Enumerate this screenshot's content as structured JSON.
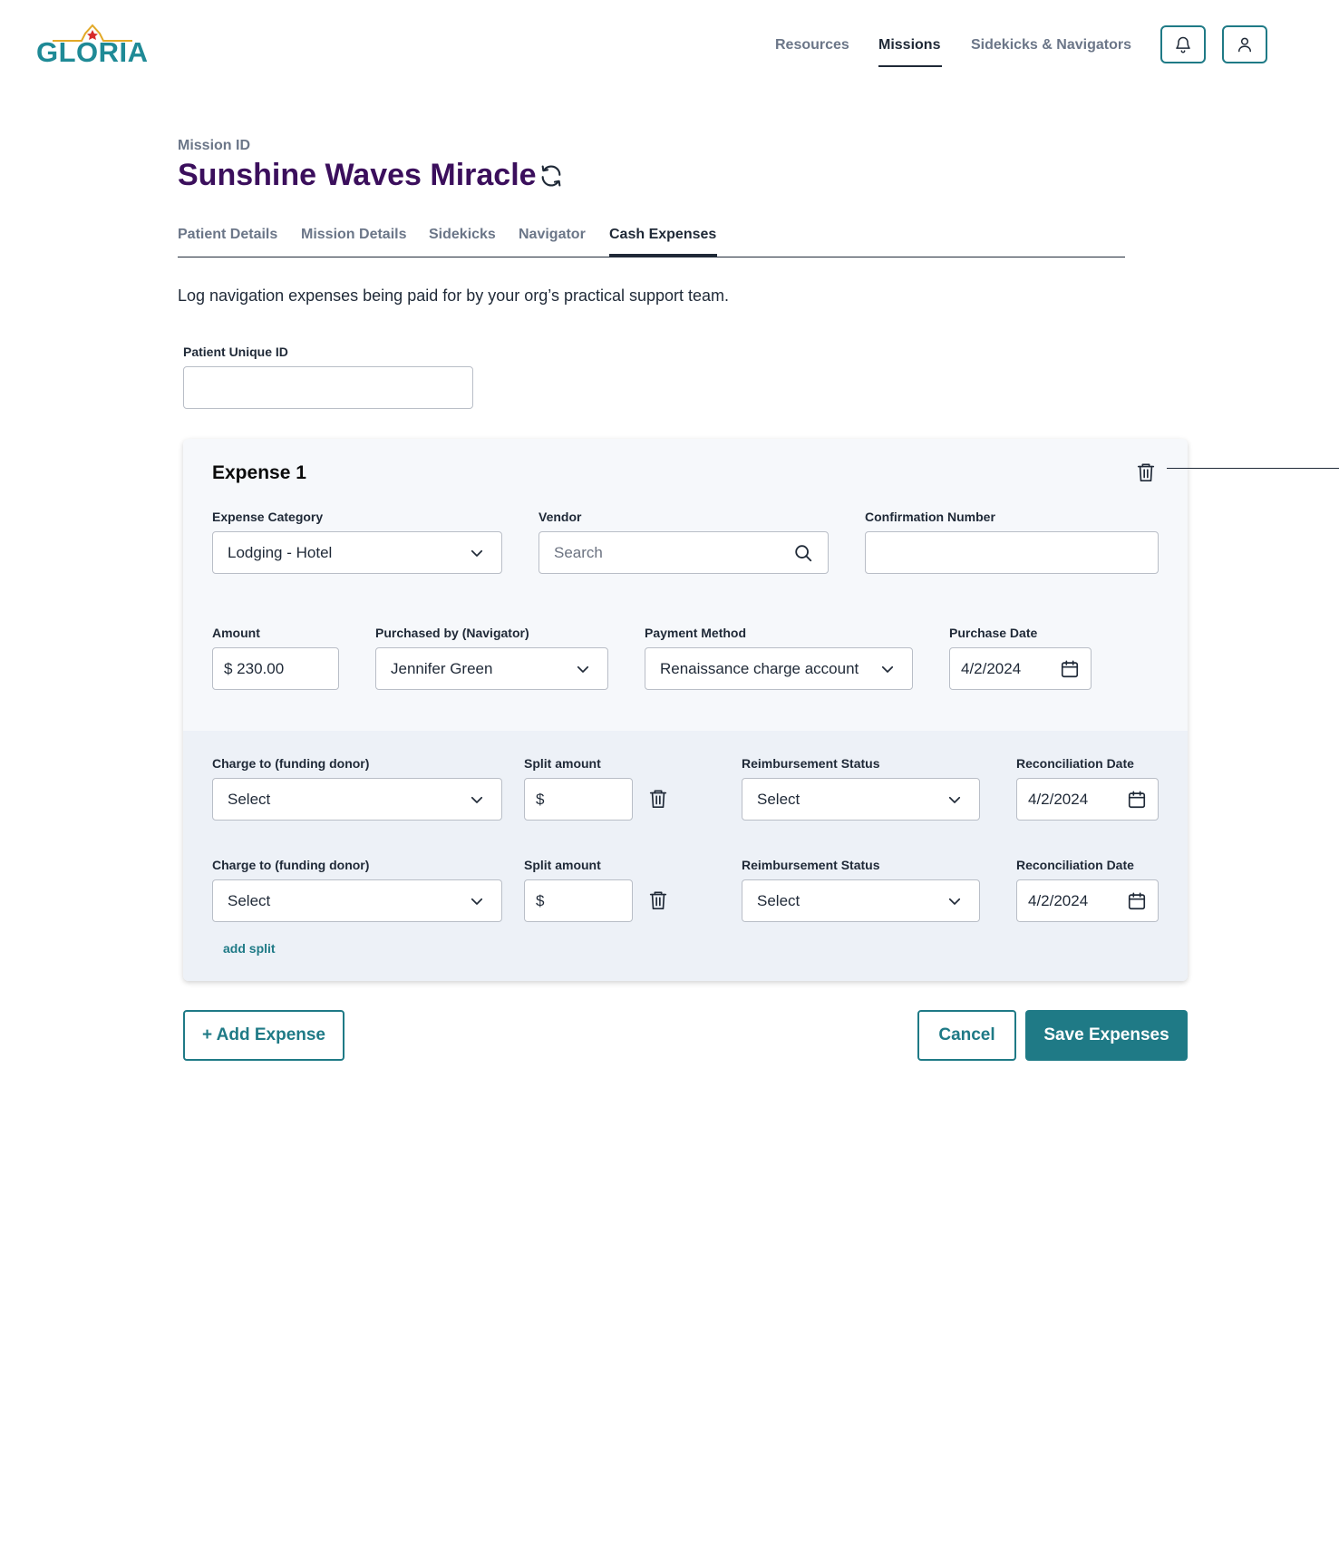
{
  "header": {
    "logo_text": "GLORIA",
    "nav": [
      {
        "label": "Resources"
      },
      {
        "label": "Missions"
      },
      {
        "label": "Sidekicks & Navigators"
      }
    ],
    "active_nav": "Missions"
  },
  "mission": {
    "id_label": "Mission ID",
    "title": "Sunshine Waves Miracle"
  },
  "tabs": [
    {
      "label": "Patient Details"
    },
    {
      "label": "Mission Details"
    },
    {
      "label": "Sidekicks"
    },
    {
      "label": "Navigator"
    },
    {
      "label": "Cash Expenses"
    }
  ],
  "active_tab": "Cash Expenses",
  "intro_text": "Log navigation expenses being paid for by your org’s practical support team.",
  "patient_id": {
    "label": "Patient Unique ID",
    "value": ""
  },
  "expense": {
    "title": "Expense 1",
    "category": {
      "label": "Expense Category",
      "value": "Lodging - Hotel"
    },
    "vendor": {
      "label": "Vendor",
      "placeholder": "Search"
    },
    "confirmation": {
      "label": "Confirmation Number",
      "value": ""
    },
    "amount": {
      "label": "Amount",
      "value": "$ 230.00"
    },
    "purchased_by": {
      "label": "Purchased by (Navigator)",
      "value": "Jennifer Green"
    },
    "payment_method": {
      "label": "Payment Method",
      "value": "Renaissance charge account"
    },
    "purchase_date": {
      "label": "Purchase Date",
      "value": "4/2/2024"
    },
    "splits": [
      {
        "charge_label": "Charge to (funding donor)",
        "charge_value": "Select",
        "split_label": "Split amount",
        "split_value": "$",
        "status_label": "Reimbursement Status",
        "status_value": "Select",
        "recon_label": "Reconciliation Date",
        "recon_value": "4/2/2024"
      },
      {
        "charge_label": "Charge to (funding donor)",
        "charge_value": "Select",
        "split_label": "Split amount",
        "split_value": "$",
        "status_label": "Reimbursement Status",
        "status_value": "Select",
        "recon_label": "Reconciliation Date",
        "recon_value": "4/2/2024"
      }
    ],
    "add_split_label": "add split"
  },
  "actions": {
    "add_expense": "+ Add Expense",
    "cancel": "Cancel",
    "save": "Save Expenses"
  },
  "colors": {
    "brand_teal": "#1f7a86",
    "title_purple": "#3b0f5c",
    "logo_gold": "#e2a928",
    "logo_star": "#d62b2b"
  }
}
